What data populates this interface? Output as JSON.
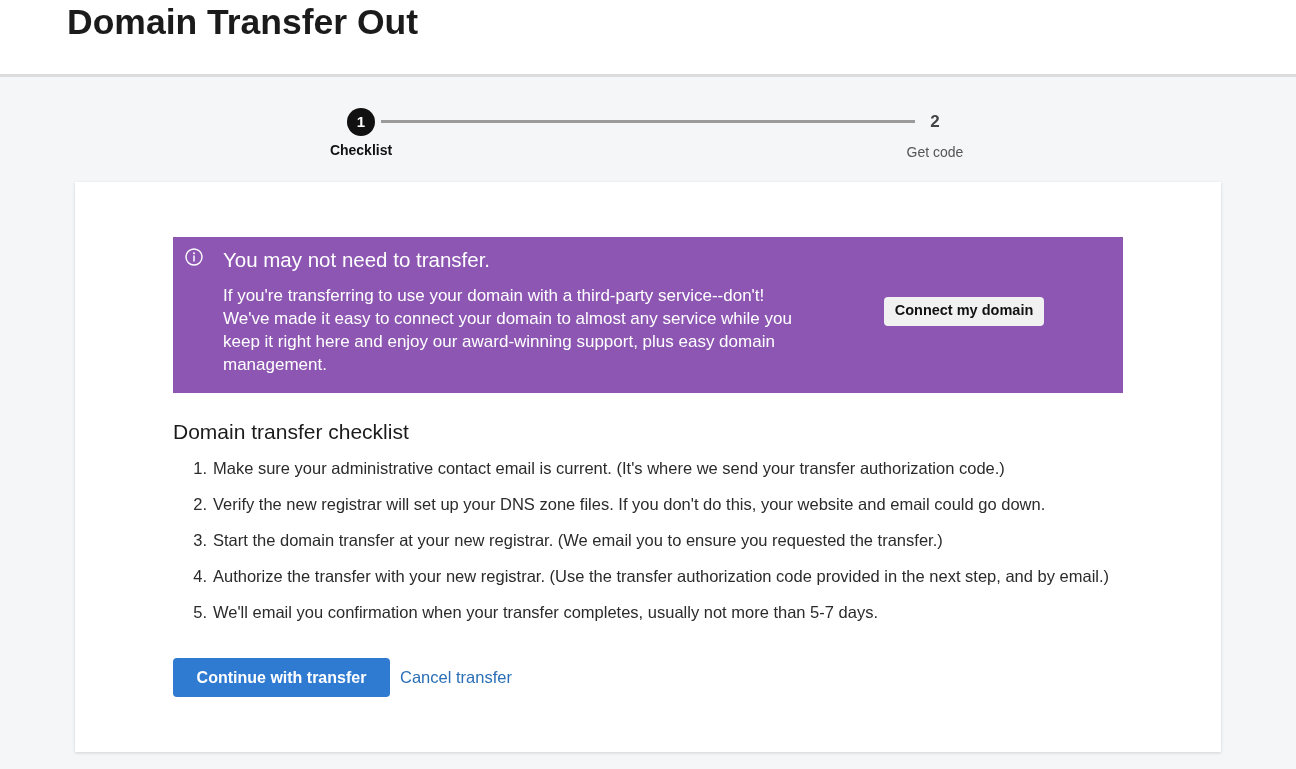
{
  "page": {
    "title": "Domain Transfer Out"
  },
  "stepper": {
    "steps": [
      {
        "number": "1",
        "label": "Checklist",
        "selected": true
      },
      {
        "number": "2",
        "label": "Get code",
        "selected": false
      }
    ]
  },
  "notice": {
    "title": "You may not need to transfer.",
    "body": "If you're transferring to use your domain with a third-party service--don't! We've made it easy to connect your domain to almost any service while you keep it right here and enjoy our award-winning support, plus easy domain management.",
    "button": "Connect my domain"
  },
  "checklist": {
    "title": "Domain transfer checklist",
    "items": [
      {
        "number": "1.",
        "text": "Make sure your administrative contact email is current. (It's where we send your transfer authorization code.)"
      },
      {
        "number": "2.",
        "text": "Verify the new registrar will set up your DNS zone files. If you don't do this, your website and email could go down."
      },
      {
        "number": "3.",
        "text": "Start the domain transfer at your new registrar. (We email you to ensure you requested the transfer.)"
      },
      {
        "number": "4.",
        "text": "Authorize the transfer with your new registrar. (Use the transfer authorization code provided in the next step, and by email.)"
      },
      {
        "number": "5.",
        "text": "We'll email you confirmation when your transfer completes, usually not more than 5-7 days."
      }
    ]
  },
  "actions": {
    "primary": "Continue with transfer",
    "link": "Cancel transfer"
  }
}
